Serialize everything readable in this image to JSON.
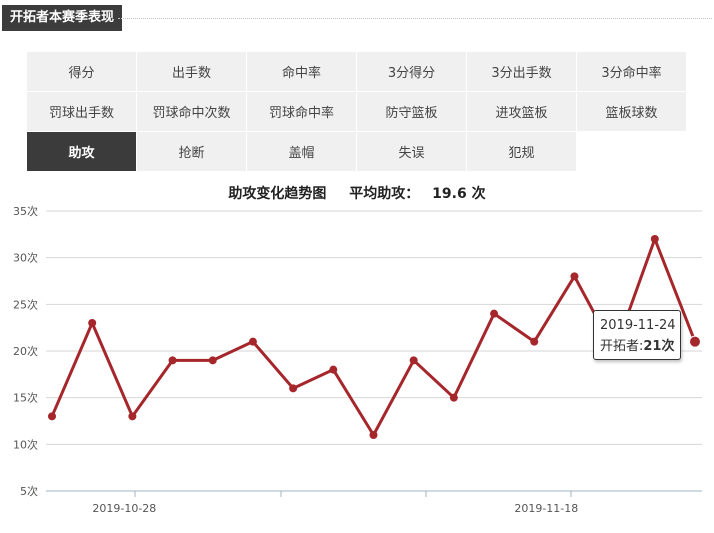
{
  "header": {
    "title": "开拓者本赛季表现"
  },
  "tabs": [
    {
      "label": "得分",
      "active": false
    },
    {
      "label": "出手数",
      "active": false
    },
    {
      "label": "命中率",
      "active": false
    },
    {
      "label": "3分得分",
      "active": false
    },
    {
      "label": "3分出手数",
      "active": false
    },
    {
      "label": "3分命中率",
      "active": false
    },
    {
      "label": "罚球出手数",
      "active": false
    },
    {
      "label": "罚球命中次数",
      "active": false
    },
    {
      "label": "罚球命中率",
      "active": false
    },
    {
      "label": "防守篮板",
      "active": false
    },
    {
      "label": "进攻篮板",
      "active": false
    },
    {
      "label": "篮板球数",
      "active": false
    },
    {
      "label": "助攻",
      "active": true
    },
    {
      "label": "抢断",
      "active": false
    },
    {
      "label": "盖帽",
      "active": false
    },
    {
      "label": "失误",
      "active": false
    },
    {
      "label": "犯规",
      "active": false
    }
  ],
  "chart_title": {
    "text": "助攻变化趋势图",
    "avg_label": "平均助攻：",
    "avg_value": "19.6 次"
  },
  "tooltip": {
    "date": "2019-11-24",
    "series_label": "开拓者:",
    "value": "21次"
  },
  "chart_data": {
    "type": "line",
    "series": [
      {
        "name": "开拓者",
        "color": "#a5262b",
        "values": [
          13,
          23,
          13,
          19,
          19,
          21,
          16,
          18,
          11,
          19,
          15,
          24,
          21,
          28,
          20,
          32,
          21
        ]
      }
    ],
    "highlight_index": 16,
    "ylim": [
      5,
      35
    ],
    "yticks": [
      35,
      30,
      25,
      20,
      15,
      10,
      5
    ],
    "ytick_unit": "次",
    "x_tick_labels": [
      {
        "label": "2019-10-28",
        "index": 1.8
      },
      {
        "label": "2019-11-18",
        "index": 12.3
      }
    ],
    "grid": true
  }
}
